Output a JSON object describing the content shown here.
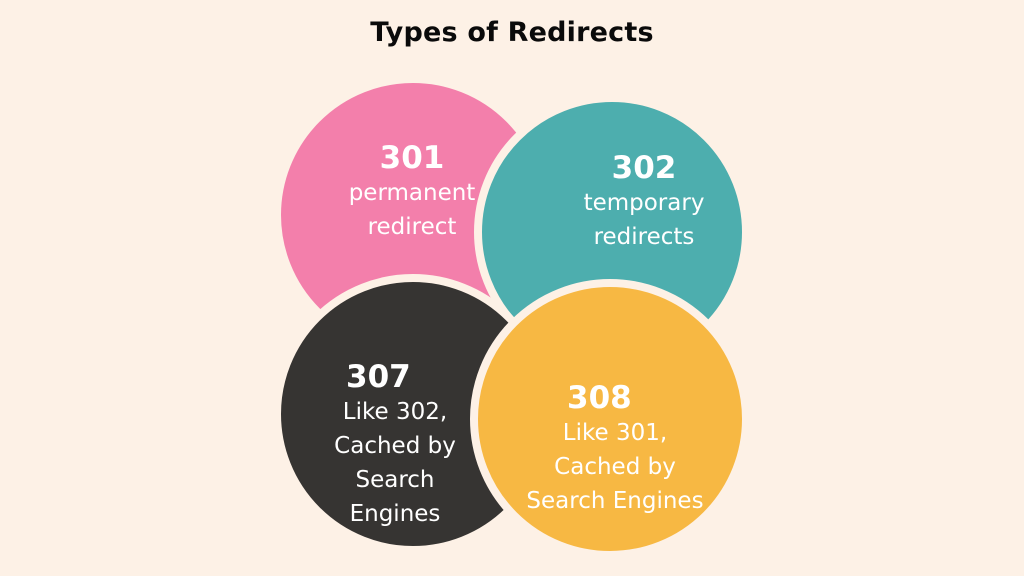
{
  "title": "Types of Redirects",
  "background_color": "#fdf1e6",
  "circles": [
    {
      "id": "301",
      "code": "301",
      "description_lines": [
        "permanent",
        "redirect"
      ],
      "color": "#f37fab"
    },
    {
      "id": "302",
      "code": "302",
      "description_lines": [
        "temporary",
        "redirects"
      ],
      "color": "#4daeae"
    },
    {
      "id": "307",
      "code": "307",
      "description_lines": [
        "Like 302,",
        "Cached by",
        "Search",
        "Engines"
      ],
      "color": "#363432"
    },
    {
      "id": "308",
      "code": "308",
      "description_lines": [
        "Like 301,",
        "Cached by",
        "Search Engines"
      ],
      "color": "#f7b843"
    }
  ]
}
